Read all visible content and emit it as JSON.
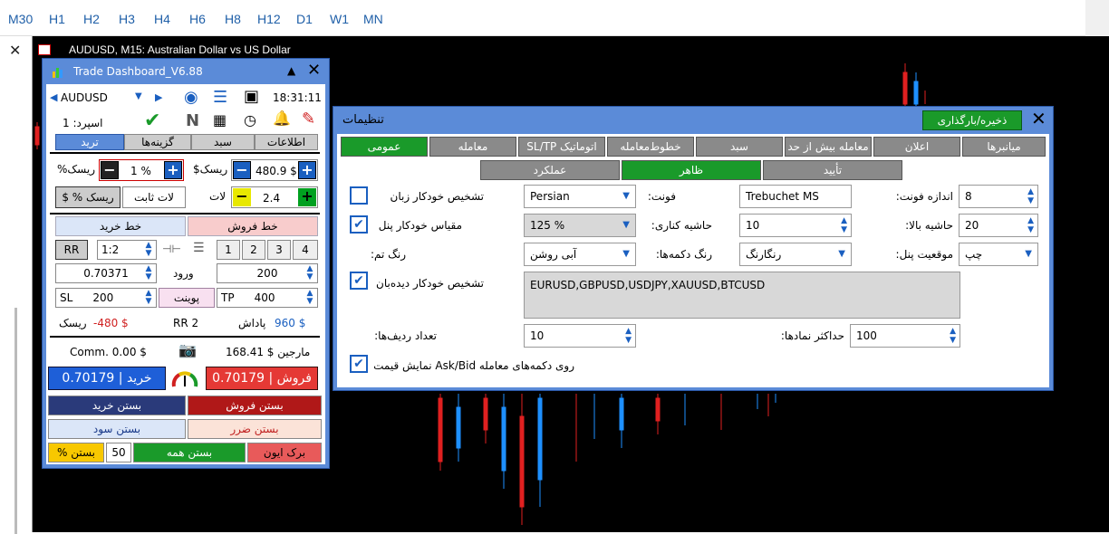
{
  "timeframes": [
    "M30",
    "H1",
    "H2",
    "H3",
    "H4",
    "H6",
    "H8",
    "H12",
    "D1",
    "W1",
    "MN"
  ],
  "chart": {
    "title": "AUDUSD, M15:  Australian Dollar vs US Dollar"
  },
  "dashboard": {
    "title": "Trade Dashboard_V6.88",
    "symbol": "AUDUSD",
    "time": "18:31:11",
    "spread_label": "اسپرد: 1",
    "tabs": [
      "اطلاعات",
      "سبد",
      "گزینه‌ها",
      "ترید"
    ],
    "risk_pct_value": "1  %",
    "risk_pct_label": "%ریسک",
    "risk_usd_value": "480.9 $",
    "risk_usd_label": "$ریسک",
    "lot_value": "2.4",
    "lot_label": "لات",
    "risk_toggle": "$ % ریسک",
    "fixed_lot": "لات ثابت",
    "buy_line": "خط خرید",
    "sell_line": "خط فروش",
    "rr_label": "RR",
    "rr_value": "1:2",
    "num_buttons": [
      "1",
      "2",
      "3",
      "4"
    ],
    "entry_price": "0.70371",
    "entry_label": "ورود",
    "points": "200",
    "sl_label": "SL",
    "sl_value": "200",
    "point_button": "پوینت",
    "tp_label": "TP",
    "tp_value": "400",
    "risk_result": "-480 $",
    "risk_result_label": "ریسک",
    "rr_result": "RR 2",
    "reward_label": "پاداش",
    "reward_value": "960 $",
    "commission": "Comm. 0.00 $",
    "margin": "168.41 $ مارجین",
    "buy_button": "خرید | 0.70179",
    "sell_button": "فروش | 0.70179",
    "close_buy": "بستن خرید",
    "close_sell": "بستن فروش",
    "close_profit": "بستن سود",
    "close_loss": "بستن ضرر",
    "close_pct": "% بستن",
    "close_pct_value": "50",
    "close_all": "بستن همه",
    "break_even": "برک ایون"
  },
  "settings": {
    "title": "تنظیمات",
    "save_load": "ذخیره/بارگذاری",
    "tabs_row1": [
      "عمومی",
      "معامله",
      "SL/TP اتوماتیک",
      "خطوط‌معامله",
      "سبد",
      "معامله بیش از حد",
      "اعلان",
      "میانبرها"
    ],
    "tabs_row2": [
      "عملکرد",
      "ظاهر",
      "تأیید"
    ],
    "auto_lang": "تشخیص خودکار زبان",
    "auto_lang_checked": false,
    "font_label": "فونت:",
    "font_value": "Trebuchet MS",
    "font_size_label": "اندازه فونت:",
    "font_size_value": "8",
    "language_value": "Persian",
    "auto_scale": "مقیاس خودکار پنل",
    "auto_scale_checked": true,
    "scale_value": "125 %",
    "margin_side_label": "حاشیه کناری:",
    "margin_side_value": "10",
    "margin_top_label": "حاشیه بالا:",
    "margin_top_value": "20",
    "theme_label": "رنگ تم:",
    "theme_value": "آبی روشن",
    "button_color_label": "رنگ دکمه‌ها:",
    "button_color_value": "رنگارنگ",
    "panel_pos_label": "موقعیت پنل:",
    "panel_pos_value": "چپ",
    "auto_watch": "تشخیص خودکار دیده‌بان",
    "auto_watch_checked": true,
    "watch_list": "EURUSD,GBPUSD,USDJPY,XAUUSD,BTCUSD",
    "rows_label": "تعداد ردیف‌ها:",
    "rows_value": "10",
    "max_symbols_label": "حداکثر نمادها:",
    "max_symbols_value": "100",
    "show_price": "روی دکمه‌های معامله Ask/Bid نمایش قیمت",
    "show_price_checked": true
  },
  "colors": {
    "accent": "#5b8bd8",
    "green": "#1a9a2a",
    "sell_red": "#e53935",
    "buy_blue": "#1e5fd8"
  }
}
